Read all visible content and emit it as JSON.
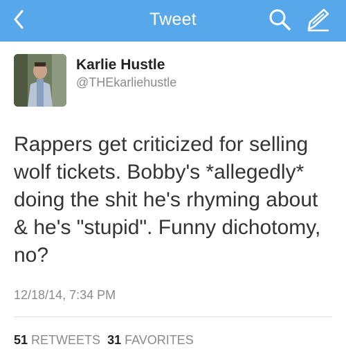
{
  "nav": {
    "title": "Tweet",
    "back_icon": "chevron-left-icon",
    "search_icon": "search-icon",
    "compose_icon": "compose-icon",
    "background": "#57a7eb"
  },
  "tweet": {
    "author_name": "Karlie Hustle",
    "author_handle": "@THEkarliehustle",
    "text": "Rappers get criticized for selling wolf tickets. Bobby's *allegedly* doing the shit he's rhyming about & he's \"stupid\". Funny dichotomy, no?",
    "timestamp": "12/18/14, 7:34 PM",
    "retweets_count": "51",
    "retweets_label": "RETWEETS",
    "favorites_count": "31",
    "favorites_label": "FAVORITES"
  }
}
